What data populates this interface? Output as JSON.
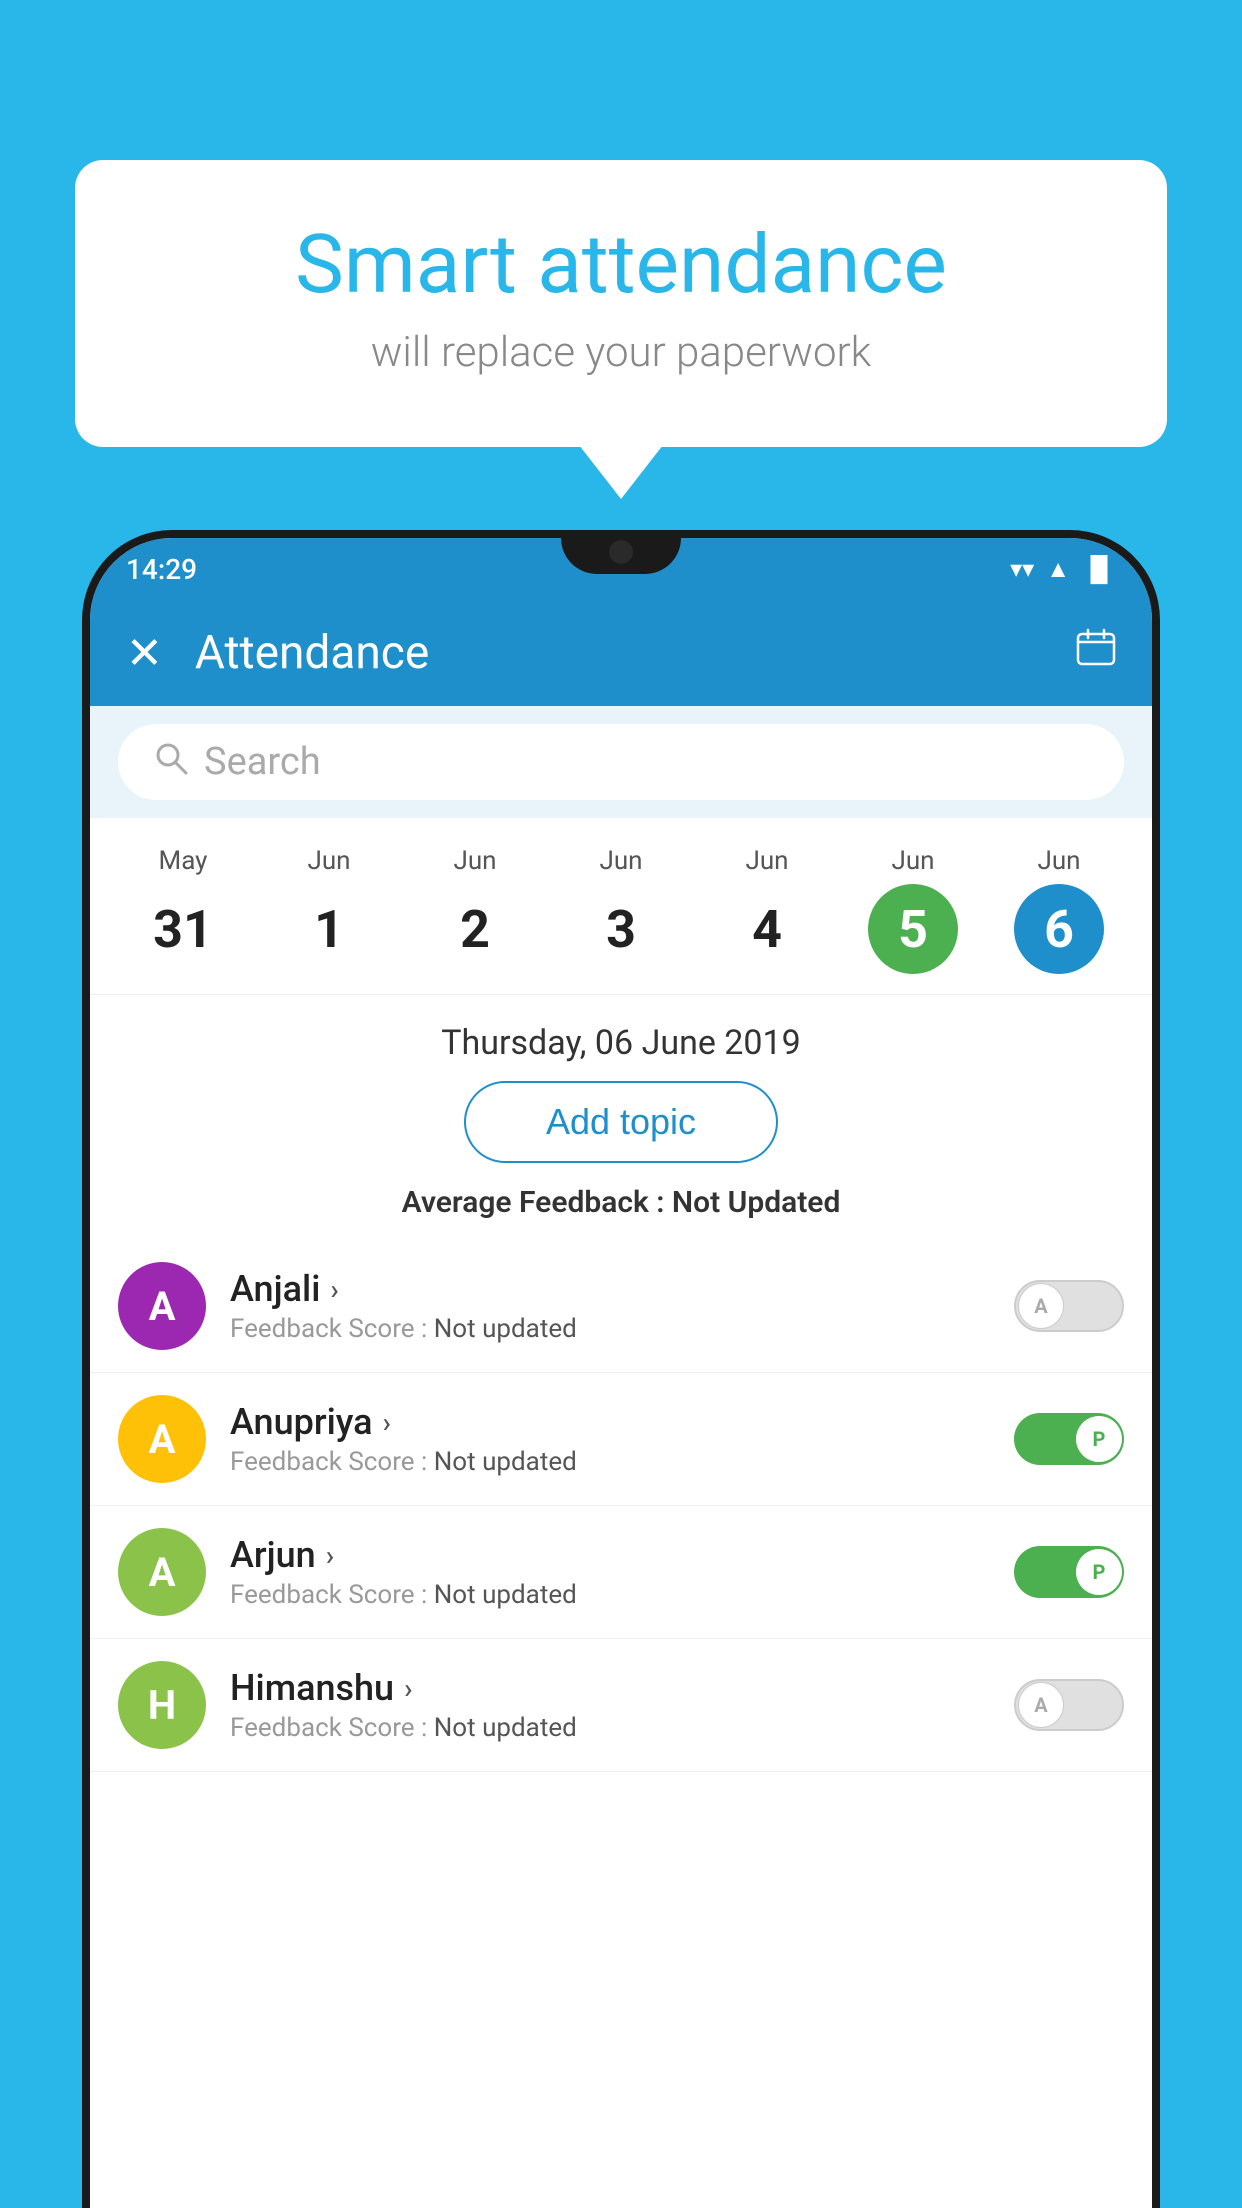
{
  "background_color": "#29b6e8",
  "bubble": {
    "title": "Smart attendance",
    "subtitle": "will replace your paperwork"
  },
  "status_bar": {
    "time": "14:29",
    "wifi": "▼",
    "signal": "▲",
    "battery": "▐"
  },
  "header": {
    "title": "Attendance",
    "close_label": "✕",
    "calendar_icon": "📅"
  },
  "search": {
    "placeholder": "Search"
  },
  "calendar": {
    "days": [
      {
        "month": "May",
        "date": "31",
        "state": "normal"
      },
      {
        "month": "Jun",
        "date": "1",
        "state": "normal"
      },
      {
        "month": "Jun",
        "date": "2",
        "state": "normal"
      },
      {
        "month": "Jun",
        "date": "3",
        "state": "normal"
      },
      {
        "month": "Jun",
        "date": "4",
        "state": "normal"
      },
      {
        "month": "Jun",
        "date": "5",
        "state": "today"
      },
      {
        "month": "Jun",
        "date": "6",
        "state": "selected"
      }
    ]
  },
  "selected_date": "Thursday, 06 June 2019",
  "add_topic_label": "Add topic",
  "average_feedback_label": "Average Feedback :",
  "average_feedback_value": "Not Updated",
  "students": [
    {
      "name": "Anjali",
      "avatar_letter": "A",
      "avatar_color": "#9c27b0",
      "feedback_label": "Feedback Score :",
      "feedback_value": "Not updated",
      "toggle_state": "off",
      "toggle_label": "A"
    },
    {
      "name": "Anupriya",
      "avatar_letter": "A",
      "avatar_color": "#ffc107",
      "feedback_label": "Feedback Score :",
      "feedback_value": "Not updated",
      "toggle_state": "on",
      "toggle_label": "P"
    },
    {
      "name": "Arjun",
      "avatar_letter": "A",
      "avatar_color": "#8bc34a",
      "feedback_label": "Feedback Score :",
      "feedback_value": "Not updated",
      "toggle_state": "on",
      "toggle_label": "P"
    },
    {
      "name": "Himanshu",
      "avatar_letter": "H",
      "avatar_color": "#8bc34a",
      "feedback_label": "Feedback Score :",
      "feedback_value": "Not updated",
      "toggle_state": "off",
      "toggle_label": "A"
    }
  ]
}
